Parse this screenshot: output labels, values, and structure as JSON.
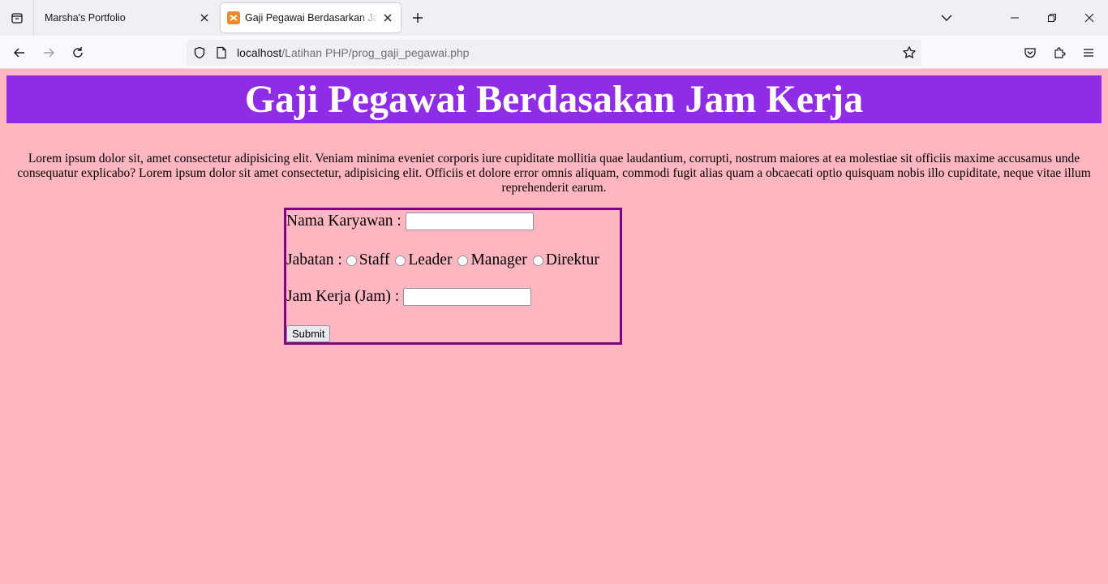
{
  "browser": {
    "tabs": [
      {
        "title": "Marsha's Portfolio",
        "active": false
      },
      {
        "title": "Gaji Pegawai Berdasarkan Jam Kerja",
        "active": true
      }
    ],
    "url": {
      "host": "localhost",
      "path": "/Latihan PHP/prog_gaji_pegawai.php"
    }
  },
  "page": {
    "heading": "Gaji Pegawai Berdasakan Jam Kerja",
    "intro": "Lorem ipsum dolor sit, amet consectetur adipisicing elit. Veniam minima eveniet corporis iure cupiditate mollitia quae laudantium, corrupti, nostrum maiores at ea molestiae sit officiis maxime accusamus unde consequatur explicabo? Lorem ipsum dolor sit amet consectetur, adipisicing elit. Officiis et dolore error omnis aliquam, commodi fugit alias quam a obcaecati optio quisquam nobis illo cupiditate, neque vitae illum reprehenderit earum.",
    "form": {
      "name_label": "Nama Karyawan :",
      "name_value": "",
      "position_label": "Jabatan :",
      "positions": [
        "Staff",
        "Leader",
        "Manager",
        "Direktur"
      ],
      "hours_label": "Jam Kerja (Jam) :",
      "hours_value": "",
      "submit_label": "Submit"
    }
  },
  "colors": {
    "page_background": "#ffb6c1",
    "banner_background": "#8f2ce6",
    "form_border": "#800080"
  }
}
